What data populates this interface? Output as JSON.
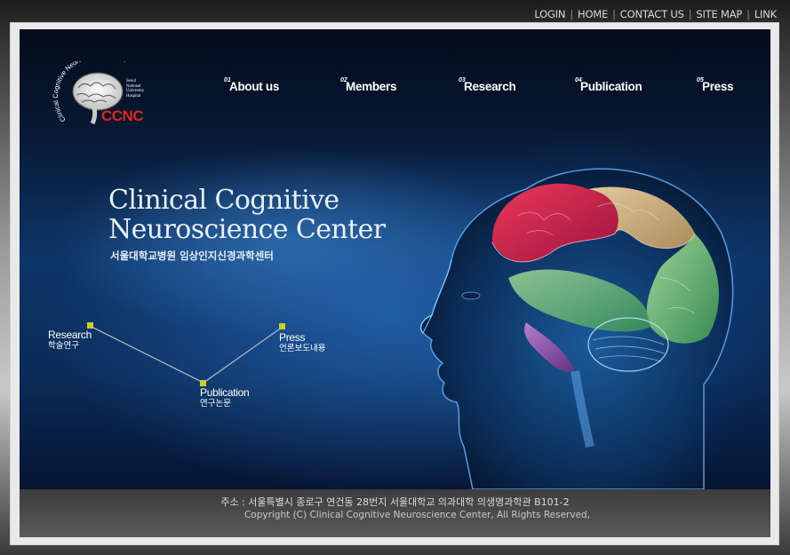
{
  "util_nav": {
    "items": [
      {
        "label": "LOGIN"
      },
      {
        "label": "HOME"
      },
      {
        "label": "CONTACT US"
      },
      {
        "label": "SITE MAP"
      },
      {
        "label": "LINK"
      }
    ]
  },
  "logo": {
    "ring_text": "Clinical Cognitive Neuroscience Center",
    "abbr": "CCNC",
    "institution": "Seoul National University Hospital"
  },
  "main_nav": {
    "items": [
      {
        "num": "01",
        "label": "About us"
      },
      {
        "num": "02",
        "label": "Members"
      },
      {
        "num": "03",
        "label": "Research"
      },
      {
        "num": "04",
        "label": "Publication"
      },
      {
        "num": "05",
        "label": "Press"
      }
    ]
  },
  "hero": {
    "title_line1": "Clinical Cognitive",
    "title_line2": "Neuroscience Center",
    "subtitle": "서울대학교병원 임상인지신경과학센터"
  },
  "quick_links": {
    "research": {
      "en": "Research",
      "ko": "학술연구"
    },
    "publication": {
      "en": "Publication",
      "ko": "연구논문"
    },
    "press": {
      "en": "Press",
      "ko": "언론보도내용"
    }
  },
  "footer": {
    "address": "주소 : 서울특별시 종로구 연건동 28번지 서울대학교 의과대학 의생명과학관 B101-2",
    "copyright": "Copyright (C) Clinical Cognitive Neuroscience Center, All Rights Reserved,"
  },
  "colors": {
    "accent_dot": "#c8d12a",
    "logo_red": "#e2231a",
    "stage_blue": "#0d3567"
  }
}
